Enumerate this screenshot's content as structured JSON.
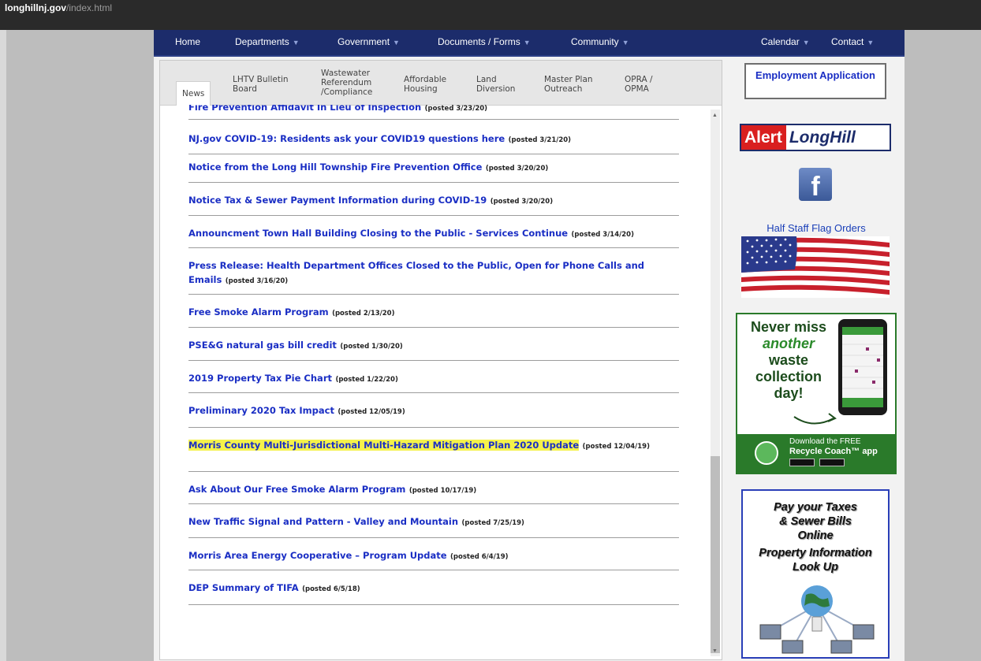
{
  "browser": {
    "url_host": "longhillnj.gov",
    "url_path": "/index.html"
  },
  "nav": {
    "items": [
      "Home",
      "Departments",
      "Government",
      "Documents / Forms",
      "Community",
      "Calendar",
      "Contact"
    ]
  },
  "tabs": [
    {
      "label": "News",
      "active": true
    },
    {
      "label": "LHTV Bulletin Board"
    },
    {
      "label": "Wastewater Referendum /Compliance"
    },
    {
      "label": "Affordable Housing"
    },
    {
      "label": "Land Diversion"
    },
    {
      "label": "Master Plan Outreach"
    },
    {
      "label": "OPRA / OPMA"
    }
  ],
  "news": [
    {
      "title": "Fire Prevention Affidavit In Lieu of Inspection",
      "posted": "(posted 3/23/20)"
    },
    {
      "title": "NJ.gov  COVID-19: Residents ask your COVID19  questions here",
      "posted": "(posted 3/21/20)"
    },
    {
      "title": "Notice from the Long Hill Township Fire Prevention Office",
      "posted": "(posted 3/20/20)"
    },
    {
      "title": "Notice Tax & Sewer Payment Information during COVID-19",
      "posted": "(posted 3/20/20)"
    },
    {
      "title": "Announcment Town Hall Building Closing to the Public - Services Continue",
      "posted": "(posted 3/14/20)"
    },
    {
      "title": "Press Release: Health Department Offices Closed to the Public, Open for Phone Calls and Emails",
      "posted": "(posted 3/16/20)"
    },
    {
      "title": "Free Smoke Alarm Program",
      "posted": "(posted 2/13/20)"
    },
    {
      "title": "PSE&G natural gas bill credit",
      "posted": "(posted 1/30/20)"
    },
    {
      "title": "2019 Property Tax Pie Chart",
      "posted": "(posted 1/22/20)"
    },
    {
      "title": "Preliminary 2020 Tax Impact",
      "posted": "(posted 12/05/19)"
    },
    {
      "title": "Morris County Multi-Jurisdictional Multi-Hazard Mitigation Plan 2020 Update",
      "posted": "(posted 12/04/19)",
      "highlighted": true
    },
    {
      "title": "Ask About Our Free Smoke Alarm Program",
      "posted": "(posted 10/17/19)"
    },
    {
      "title": "New Traffic Signal and Pattern - Valley and Mountain",
      "posted": "(posted 7/25/19)"
    },
    {
      "title": "Morris Area Energy Cooperative – Program Update",
      "posted": "(posted 6/4/19)"
    },
    {
      "title": "DEP Summary of TIFA",
      "posted": "(posted 6/5/18)"
    }
  ],
  "sidebar": {
    "employment": "Employment Application",
    "alert_part1": "Alert",
    "alert_part2": "LongHill",
    "facebook_letter": "f",
    "half_staff": "Half Staff Flag Orders",
    "recycle": {
      "line1": "Never miss",
      "line2": "another",
      "line3": "waste",
      "line4": "collection",
      "line5": "day!",
      "download1": "Download the FREE",
      "download2": "Recycle Coach™ app"
    },
    "taxes": {
      "line1": "Pay your Taxes",
      "line2": "& Sewer Bills",
      "line3": "Online",
      "line4": "Property  Information",
      "line5": "Look Up"
    }
  },
  "colors": {
    "nav_bg": "#1c2c6b",
    "link": "#1a2ec4",
    "highlight": "#f5f24a",
    "recycle_green": "#2a7a2a",
    "alert_red": "#d91f1f"
  }
}
